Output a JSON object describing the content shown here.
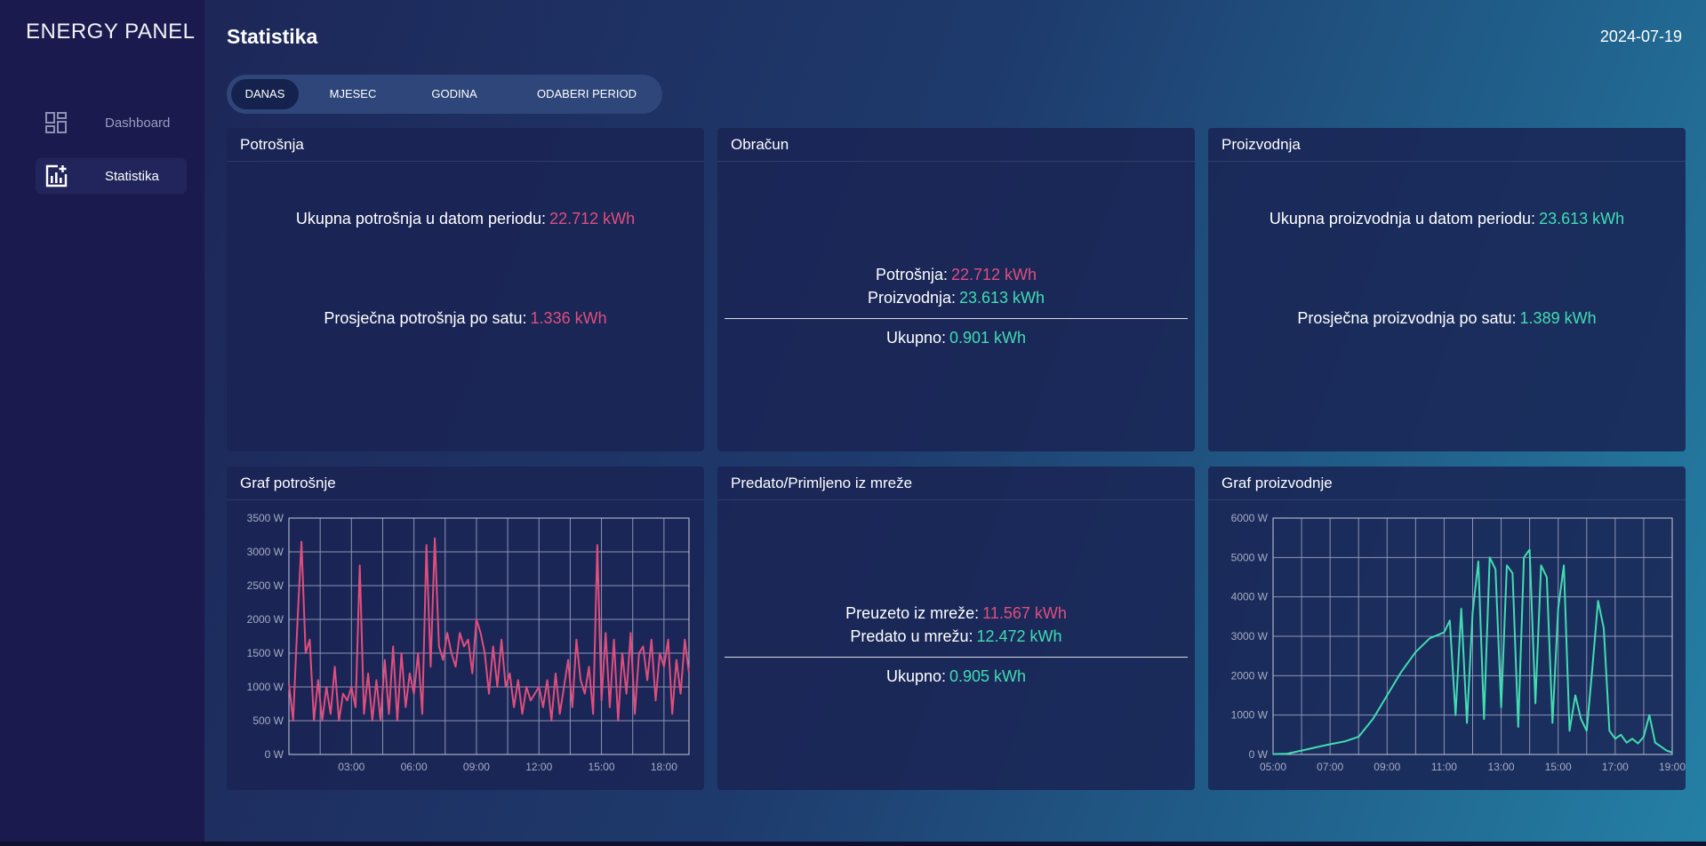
{
  "sidebar": {
    "brand": "ENERGY PANEL",
    "items": [
      {
        "label": "Dashboard",
        "icon": "dashboard-grid-icon"
      },
      {
        "label": "Statistika",
        "icon": "chart-add-icon"
      }
    ]
  },
  "header": {
    "title": "Statistika",
    "date": "2024-07-19"
  },
  "tabs": [
    {
      "label": "DANAS",
      "active": true
    },
    {
      "label": "MJESEC",
      "active": false
    },
    {
      "label": "GODINA",
      "active": false
    },
    {
      "label": "ODABERI PERIOD",
      "active": false
    }
  ],
  "cards": {
    "potrosnja": {
      "title": "Potrošnja",
      "total_label": "Ukupna potrošnja u datom periodu:",
      "total_value": "22.712 kWh",
      "avg_label": "Prosječna potrošnja po satu:",
      "avg_value": "1.336 kWh"
    },
    "obracun": {
      "title": "Obračun",
      "cons_label": "Potrošnja:",
      "cons_value": "22.712 kWh",
      "prod_label": "Proizvodnja:",
      "prod_value": "23.613 kWh",
      "total_label": "Ukupno:",
      "total_value": "0.901 kWh"
    },
    "proizvodnja": {
      "title": "Proizvodnja",
      "total_label": "Ukupna proizvodnja u datom periodu:",
      "total_value": "23.613 kWh",
      "avg_label": "Prosječna proizvodnja po satu:",
      "avg_value": "1.389 kWh"
    },
    "graf_potrosnje": {
      "title": "Graf potrošnje"
    },
    "mreza": {
      "title": "Predato/Primljeno iz mreže",
      "in_label": "Preuzeto iz mreže:",
      "in_value": "11.567 kWh",
      "out_label": "Predato u mrežu:",
      "out_value": "12.472 kWh",
      "total_label": "Ukupno:",
      "total_value": "0.905 kWh"
    },
    "graf_proizvodnje": {
      "title": "Graf proizvodnje"
    }
  },
  "colors": {
    "consumption": "#e04e7d",
    "production": "#42dcb2"
  },
  "chart_data": [
    {
      "type": "line",
      "name": "consumption",
      "color": "#e04e7d",
      "xlim": [
        0,
        19.2
      ],
      "ylim": [
        0,
        3500
      ],
      "yticks": [
        0,
        500,
        1000,
        1500,
        2000,
        2500,
        3000,
        3500
      ],
      "ytick_labels": [
        "0 W",
        "500 W",
        "1000 W",
        "1500 W",
        "2000 W",
        "2500 W",
        "3000 W",
        "3500 W"
      ],
      "xticks": [
        3,
        6,
        9,
        12,
        15,
        18
      ],
      "xtick_labels": [
        "03:00",
        "06:00",
        "09:00",
        "12:00",
        "15:00",
        "18:00"
      ],
      "x": [
        0,
        0.2,
        0.4,
        0.6,
        0.8,
        1,
        1.2,
        1.4,
        1.6,
        1.8,
        2,
        2.2,
        2.4,
        2.6,
        2.8,
        3,
        3.2,
        3.4,
        3.6,
        3.8,
        4,
        4.2,
        4.4,
        4.6,
        4.8,
        5,
        5.2,
        5.4,
        5.6,
        5.8,
        6,
        6.2,
        6.4,
        6.6,
        6.8,
        7,
        7.2,
        7.4,
        7.6,
        7.8,
        8,
        8.2,
        8.4,
        8.6,
        8.8,
        9,
        9.2,
        9.4,
        9.6,
        9.8,
        10,
        10.2,
        10.4,
        10.6,
        10.8,
        11,
        11.2,
        11.4,
        11.6,
        11.8,
        12,
        12.2,
        12.4,
        12.6,
        12.8,
        13,
        13.2,
        13.4,
        13.6,
        13.8,
        14,
        14.2,
        14.4,
        14.6,
        14.8,
        15,
        15.2,
        15.4,
        15.6,
        15.8,
        16,
        16.2,
        16.4,
        16.6,
        16.8,
        17,
        17.2,
        17.4,
        17.6,
        17.8,
        18,
        18.2,
        18.4,
        18.6,
        18.8,
        19,
        19.2
      ],
      "y": [
        1050,
        500,
        1900,
        3150,
        1500,
        1700,
        500,
        1100,
        500,
        1000,
        600,
        1300,
        500,
        900,
        800,
        1000,
        700,
        2800,
        600,
        1200,
        500,
        1100,
        500,
        1400,
        600,
        1600,
        500,
        1500,
        700,
        1200,
        900,
        1500,
        600,
        3100,
        1300,
        3200,
        1600,
        1400,
        1800,
        1500,
        1300,
        1800,
        1600,
        1700,
        1200,
        2000,
        1800,
        1500,
        900,
        1600,
        1000,
        1700,
        1000,
        1200,
        700,
        1100,
        600,
        1000,
        800,
        900,
        1000,
        700,
        1100,
        500,
        1200,
        600,
        1000,
        1400,
        700,
        1700,
        1100,
        900,
        1300,
        600,
        3100,
        800,
        1800,
        700,
        1700,
        500,
        1500,
        900,
        1800,
        600,
        1500,
        1600,
        1100,
        1700,
        800,
        1500,
        1300,
        1700,
        600,
        1400,
        900,
        1700,
        1200
      ]
    },
    {
      "type": "line",
      "name": "production",
      "color": "#42dcb2",
      "xlim": [
        5,
        19
      ],
      "ylim": [
        0,
        6000
      ],
      "yticks": [
        0,
        1000,
        2000,
        3000,
        4000,
        5000,
        6000
      ],
      "ytick_labels": [
        "0 W",
        "1000 W",
        "2000 W",
        "3000 W",
        "4000 W",
        "5000 W",
        "6000 W"
      ],
      "xticks": [
        5,
        7,
        9,
        11,
        13,
        15,
        17,
        19
      ],
      "xtick_labels": [
        "05:00",
        "07:00",
        "09:00",
        "11:00",
        "13:00",
        "15:00",
        "17:00",
        "19:00"
      ],
      "x": [
        5,
        5.5,
        6,
        6.5,
        7,
        7.5,
        8,
        8.5,
        9,
        9.5,
        10,
        10.5,
        11,
        11.2,
        11.4,
        11.6,
        11.8,
        12,
        12.2,
        12.4,
        12.6,
        12.8,
        13,
        13.2,
        13.4,
        13.6,
        13.8,
        14,
        14.2,
        14.4,
        14.6,
        14.8,
        15,
        15.2,
        15.4,
        15.6,
        15.8,
        16,
        16.2,
        16.4,
        16.6,
        16.8,
        17,
        17.2,
        17.4,
        17.6,
        17.8,
        18,
        18.2,
        18.4,
        18.6,
        18.8,
        19
      ],
      "y": [
        10,
        20,
        100,
        180,
        260,
        330,
        450,
        900,
        1500,
        2100,
        2600,
        2950,
        3100,
        3400,
        1000,
        3700,
        800,
        3600,
        4900,
        900,
        5000,
        4700,
        1200,
        4800,
        4600,
        700,
        5000,
        5200,
        1300,
        4800,
        4500,
        800,
        3700,
        4800,
        600,
        1500,
        900,
        600,
        2200,
        3900,
        3200,
        600,
        400,
        500,
        300,
        400,
        280,
        450,
        1000,
        300,
        200,
        100,
        50
      ]
    }
  ]
}
